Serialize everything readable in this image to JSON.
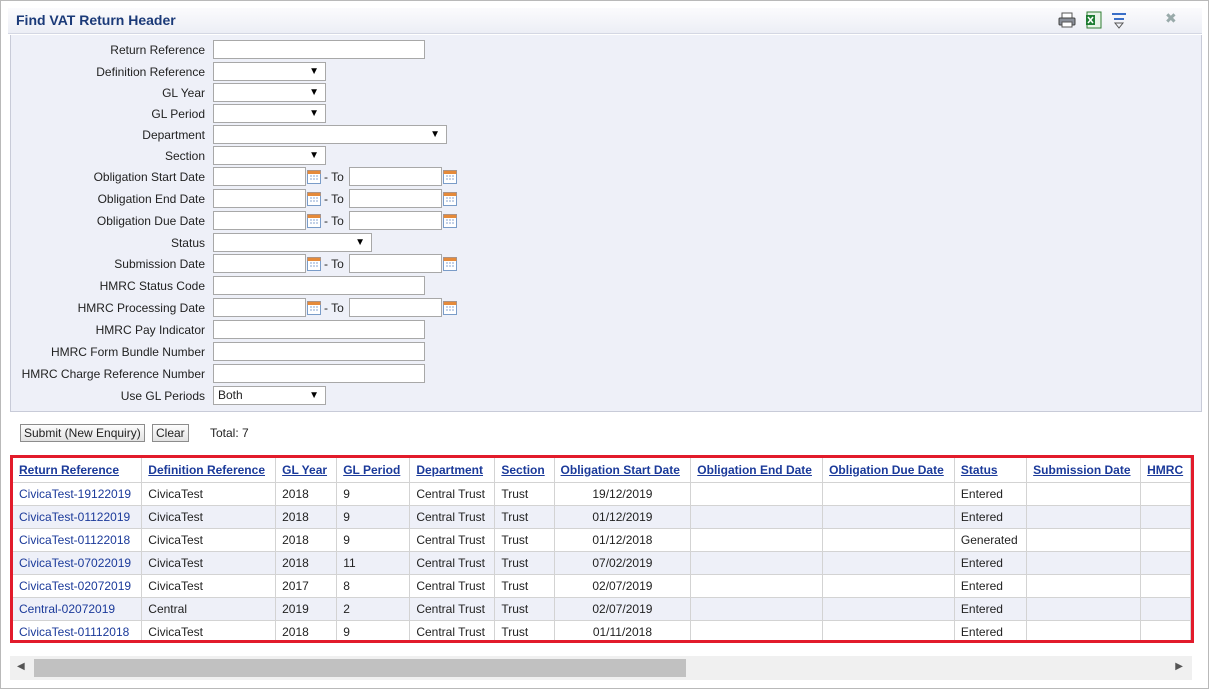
{
  "title": "Find VAT Return Header",
  "toolbar": {
    "print_icon": "printer-icon",
    "excel_icon": "excel-icon",
    "filter_icon": "filter-icon",
    "close_icon": "close-icon",
    "close_glyph": "✖"
  },
  "form": {
    "return_reference": {
      "label": "Return Reference",
      "value": ""
    },
    "definition_reference": {
      "label": "Definition Reference",
      "value": ""
    },
    "gl_year": {
      "label": "GL Year",
      "value": ""
    },
    "gl_period": {
      "label": "GL Period",
      "value": ""
    },
    "department": {
      "label": "Department",
      "value": ""
    },
    "section": {
      "label": "Section",
      "value": ""
    },
    "obligation_start_date": {
      "label": "Obligation Start Date",
      "from": "",
      "to": ""
    },
    "obligation_end_date": {
      "label": "Obligation End Date",
      "from": "",
      "to": ""
    },
    "obligation_due_date": {
      "label": "Obligation Due Date",
      "from": "",
      "to": ""
    },
    "status": {
      "label": "Status",
      "value": ""
    },
    "submission_date": {
      "label": "Submission Date",
      "from": "",
      "to": ""
    },
    "hmrc_status_code": {
      "label": "HMRC Status Code",
      "value": ""
    },
    "hmrc_processing_date": {
      "label": "HMRC Processing Date",
      "from": "",
      "to": ""
    },
    "hmrc_pay_indicator": {
      "label": "HMRC Pay Indicator",
      "value": ""
    },
    "hmrc_form_bundle_number": {
      "label": "HMRC Form Bundle Number",
      "value": ""
    },
    "hmrc_charge_reference_number": {
      "label": "HMRC Charge Reference Number",
      "value": ""
    },
    "use_gl_periods": {
      "label": "Use GL Periods",
      "value": "Both"
    },
    "to_label": "- To",
    "dropdown_arrow": "▼"
  },
  "actions": {
    "submit_label": "Submit (New Enquiry)",
    "clear_label": "Clear",
    "total_text": "Total: 7"
  },
  "table": {
    "columns": [
      "Return Reference",
      "Definition Reference",
      "GL Year",
      "GL Period",
      "Department",
      "Section",
      "Obligation Start Date",
      "Obligation End Date",
      "Obligation Due Date",
      "Status",
      "Submission Date",
      "HMRC"
    ],
    "rows": [
      [
        "CivicaTest-19122019",
        "CivicaTest",
        "2018",
        "9",
        "Central Trust",
        "Trust",
        "19/12/2019",
        "",
        "",
        "Entered",
        "",
        ""
      ],
      [
        "CivicaTest-01122019",
        "CivicaTest",
        "2018",
        "9",
        "Central Trust",
        "Trust",
        "01/12/2019",
        "",
        "",
        "Entered",
        "",
        ""
      ],
      [
        "CivicaTest-01122018",
        "CivicaTest",
        "2018",
        "9",
        "Central Trust",
        "Trust",
        "01/12/2018",
        "",
        "",
        "Generated",
        "",
        ""
      ],
      [
        "CivicaTest-07022019",
        "CivicaTest",
        "2018",
        "11",
        "Central Trust",
        "Trust",
        "07/02/2019",
        "",
        "",
        "Entered",
        "",
        ""
      ],
      [
        "CivicaTest-02072019",
        "CivicaTest",
        "2017",
        "8",
        "Central Trust",
        "Trust",
        "02/07/2019",
        "",
        "",
        "Entered",
        "",
        ""
      ],
      [
        "Central-02072019",
        "Central",
        "2019",
        "2",
        "Central Trust",
        "Trust",
        "02/07/2019",
        "",
        "",
        "Entered",
        "",
        ""
      ],
      [
        "CivicaTest-01112018",
        "CivicaTest",
        "2018",
        "9",
        "Central Trust",
        "Trust",
        "01/11/2018",
        "",
        "",
        "Entered",
        "",
        ""
      ]
    ]
  },
  "scroll": {
    "left_arrow": "◀",
    "right_arrow": "▶"
  }
}
